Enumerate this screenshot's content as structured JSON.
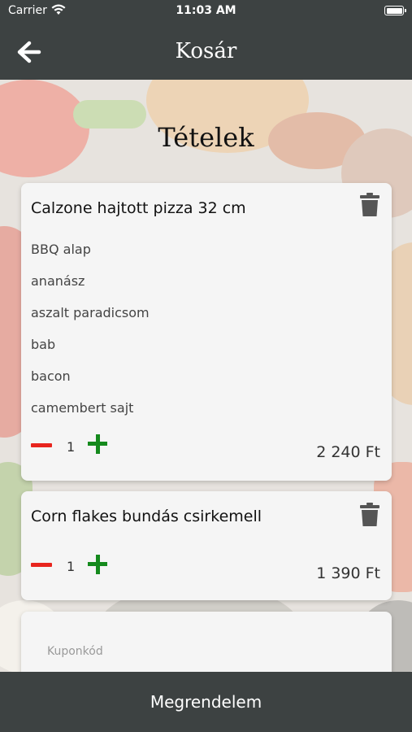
{
  "status_bar": {
    "carrier": "Carrier",
    "time": "11:03 AM"
  },
  "nav": {
    "title": "Kosár",
    "back_icon": "arrow-left-icon"
  },
  "section_title": "Tételek",
  "cart_items": [
    {
      "name": "Calzone hajtott pizza 32 cm",
      "toppings": [
        "BBQ alap",
        "ananász",
        "aszalt paradicsom",
        "bab",
        "bacon",
        "camembert sajt"
      ],
      "quantity": "1",
      "price": "2 240 Ft"
    },
    {
      "name": "Corn flakes bundás csirkemell",
      "toppings": [],
      "quantity": "1",
      "price": "1 390 Ft"
    }
  ],
  "coupon": {
    "placeholder": "Kuponkód"
  },
  "order_button": {
    "label": "Megrendelem"
  },
  "colors": {
    "bar": "#3d4242",
    "minus": "#e8251e",
    "plus": "#158a1d",
    "card": "#f5f5f5"
  }
}
